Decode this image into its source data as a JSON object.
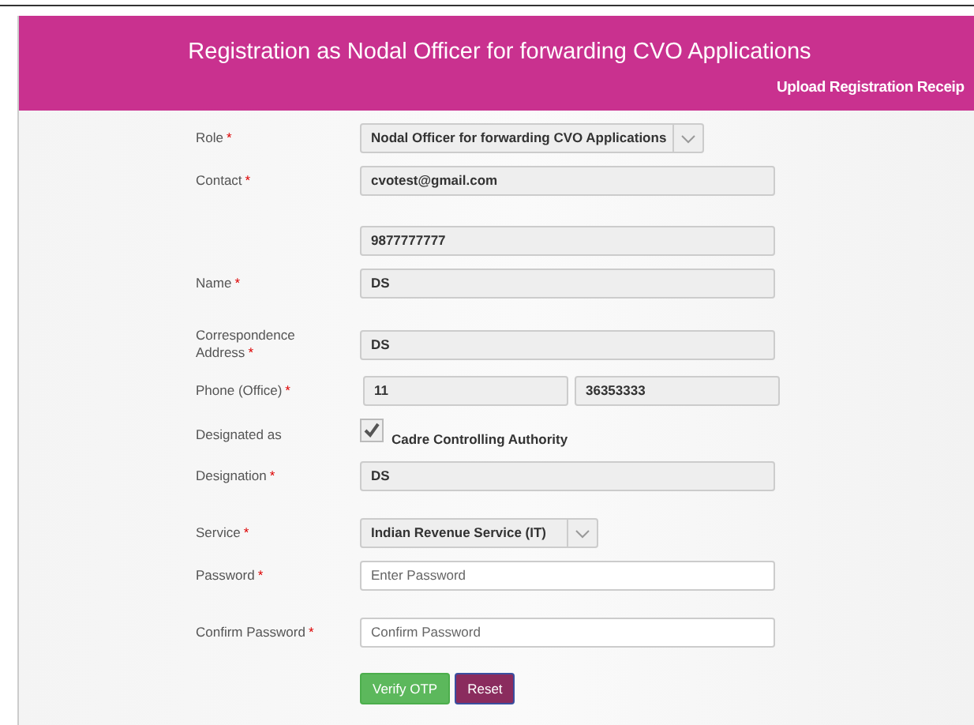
{
  "header": {
    "title": "Registration as Nodal Officer for forwarding CVO Applications",
    "link": "Upload Registration Receip"
  },
  "rows": [
    {
      "kind": "select",
      "label": "Role",
      "mark": "*",
      "value": "Nodal Officer for forwarding CVO Applications"
    },
    {
      "kind": "text",
      "label": "Contact",
      "mark": "*",
      "value": "cvotest@gmail.com"
    },
    {
      "kind": "text",
      "value": "9877777777"
    },
    {
      "kind": "text",
      "label": "Name",
      "mark": "*",
      "value": "DS"
    },
    {
      "kind": "text",
      "label": "Correspondence Address",
      "mark": "*",
      "value": "DS"
    },
    {
      "kind": "phone",
      "label": "Phone (Office)",
      "mark": "*",
      "values": [
        "11",
        "36353333"
      ]
    },
    {
      "kind": "checkbox",
      "label": "Designated as",
      "checked": true,
      "option": "Cadre Controlling Authority"
    },
    {
      "kind": "text",
      "label": "Designation",
      "mark": "*",
      "value": "DS"
    },
    {
      "kind": "select",
      "label": "Service",
      "mark": "*",
      "value": "Indian Revenue Service (IT)"
    },
    {
      "kind": "password",
      "label": "Password",
      "mark": "*",
      "placeholder": "Enter Password"
    },
    {
      "kind": "password",
      "label": "Confirm Password",
      "mark": "*",
      "placeholder": "Confirm Password"
    }
  ],
  "buttons": [
    {
      "label": "Verify OTP",
      "kind": "primary"
    },
    {
      "label": "Reset",
      "kind": "secondary"
    }
  ]
}
